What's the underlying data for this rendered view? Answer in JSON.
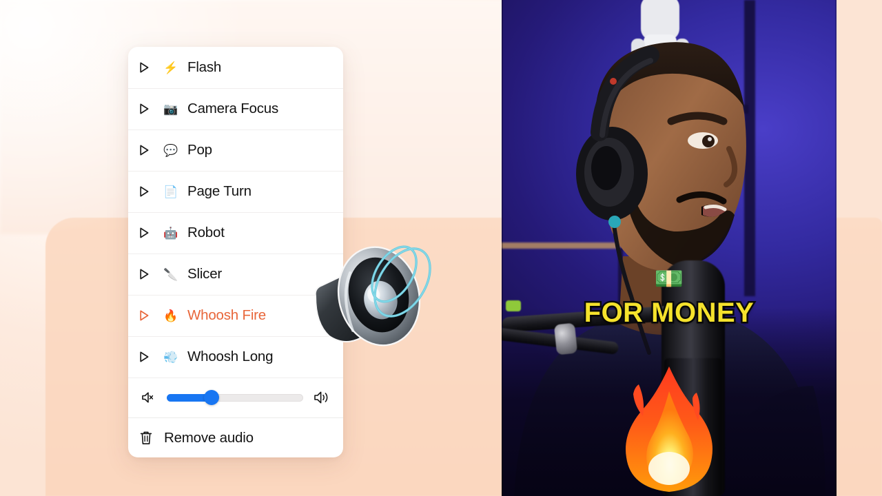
{
  "background": {
    "base_color": "#fff6f0",
    "peach_block_color": "#fcdcc6"
  },
  "sound_menu": {
    "panel_name": "Sound effects menu",
    "accent_color": "#e8663a",
    "slider_color": "#1876f2",
    "items": [
      {
        "label": "Flash",
        "emoji": "⚡",
        "icon_name": "high-voltage-emoji",
        "active": false
      },
      {
        "label": "Camera Focus",
        "emoji": "📷",
        "icon_name": "camera-emoji",
        "active": false
      },
      {
        "label": "Pop",
        "emoji": "💬",
        "icon_name": "speech-balloon-emoji",
        "active": false
      },
      {
        "label": "Page Turn",
        "emoji": "📄",
        "icon_name": "page-emoji",
        "active": false
      },
      {
        "label": "Robot",
        "emoji": "🤖",
        "icon_name": "robot-emoji",
        "active": false
      },
      {
        "label": "Slicer",
        "emoji": "🔪",
        "icon_name": "knife-emoji",
        "active": false
      },
      {
        "label": "Whoosh Fire",
        "emoji": "🔥",
        "icon_name": "fire-emoji",
        "active": true
      },
      {
        "label": "Whoosh Long",
        "emoji": "💨",
        "icon_name": "dash-emoji",
        "active": false
      }
    ],
    "volume": {
      "name": "volume-slider",
      "value_percent": 33,
      "mute_icon_name": "speaker-muted-icon",
      "max_icon_name": "speaker-loud-icon"
    },
    "remove_audio": {
      "label": "Remove audio",
      "icon_name": "trash-icon"
    }
  },
  "decor": {
    "speaker_art_name": "loudspeaker-3d-illustration"
  },
  "video": {
    "name": "video-preview",
    "caption_text": "FOR MONEY",
    "caption_color": "#f5e22c",
    "caption_outline": "#0b0b0b",
    "money_emoji": "💵",
    "fire_emoji_name": "fire-overlay-emoji",
    "scene": "podcast host wearing headphones speaking into a microphone in a blue-lit studio"
  }
}
